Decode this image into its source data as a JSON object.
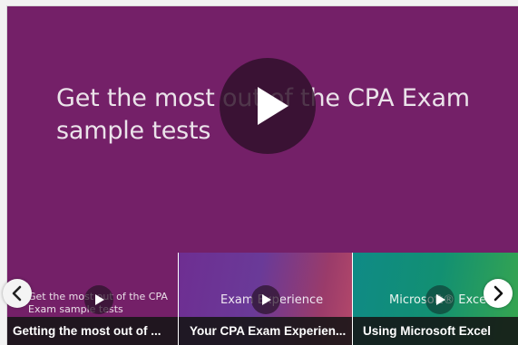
{
  "main_video": {
    "title": "Get the most out of the CPA Exam sample tests",
    "play_icon": "play-icon",
    "background": "#742068"
  },
  "playlist": [
    {
      "art_text": "Get the most out of the CPA Exam sample tests",
      "caption": "Getting the most out of ...",
      "play_icon": "play-icon"
    },
    {
      "art_text": "Exam Experience",
      "caption": "Your CPA Exam Experien...",
      "play_icon": "play-icon"
    },
    {
      "art_text": "Microsoft® Excel™",
      "caption": "Using Microsoft Excel",
      "play_icon": "play-icon"
    }
  ],
  "nav": {
    "prev_icon": "chevron-left-icon",
    "next_icon": "chevron-right-icon"
  }
}
